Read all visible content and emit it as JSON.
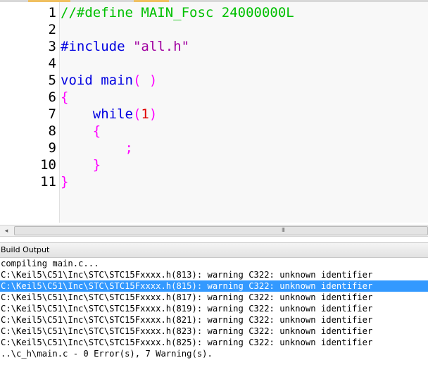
{
  "editor": {
    "lines": [
      {
        "num": "1",
        "segments": [
          {
            "text": "//#define MAIN_Fosc 24000000L",
            "cls": "c-comment"
          }
        ]
      },
      {
        "num": "2",
        "segments": []
      },
      {
        "num": "3",
        "segments": [
          {
            "text": "#include ",
            "cls": "c-kw"
          },
          {
            "text": "\"all.h\"",
            "cls": "c-str"
          }
        ]
      },
      {
        "num": "4",
        "segments": []
      },
      {
        "num": "5",
        "segments": [
          {
            "text": "void",
            "cls": "c-kw"
          },
          {
            "text": " main",
            "cls": "c-kw"
          },
          {
            "text": "( )",
            "cls": "c-paren"
          }
        ]
      },
      {
        "num": "6",
        "segments": [
          {
            "text": "{",
            "cls": "c-paren"
          }
        ]
      },
      {
        "num": "7",
        "segments": [
          {
            "text": "    while",
            "cls": "c-kw"
          },
          {
            "text": "(",
            "cls": "c-paren"
          },
          {
            "text": "1",
            "cls": "c-num"
          },
          {
            "text": ")",
            "cls": "c-paren"
          }
        ]
      },
      {
        "num": "8",
        "segments": [
          {
            "text": "    {",
            "cls": "c-paren"
          }
        ]
      },
      {
        "num": "9",
        "segments": [
          {
            "text": "        ;",
            "cls": "c-paren"
          }
        ]
      },
      {
        "num": "10",
        "segments": [
          {
            "text": "    }",
            "cls": "c-paren"
          }
        ]
      },
      {
        "num": "11",
        "segments": [
          {
            "text": "}",
            "cls": "c-paren"
          }
        ]
      }
    ]
  },
  "scrollbar": {
    "left_arrow": "◂",
    "grip": "III"
  },
  "build_output": {
    "title": "Build Output",
    "selected_index": 2,
    "lines": [
      "compiling main.c...",
      "C:\\Keil5\\C51\\Inc\\STC\\STC15Fxxxx.h(813): warning C322: unknown identifier",
      "C:\\Keil5\\C51\\Inc\\STC\\STC15Fxxxx.h(815): warning C322: unknown identifier",
      "C:\\Keil5\\C51\\Inc\\STC\\STC15Fxxxx.h(817): warning C322: unknown identifier",
      "C:\\Keil5\\C51\\Inc\\STC\\STC15Fxxxx.h(819): warning C322: unknown identifier",
      "C:\\Keil5\\C51\\Inc\\STC\\STC15Fxxxx.h(821): warning C322: unknown identifier",
      "C:\\Keil5\\C51\\Inc\\STC\\STC15Fxxxx.h(823): warning C322: unknown identifier",
      "C:\\Keil5\\C51\\Inc\\STC\\STC15Fxxxx.h(825): warning C322: unknown identifier",
      "..\\c_h\\main.c - 0 Error(s), 7 Warning(s)."
    ]
  },
  "colors": {
    "comment": "#00c000",
    "keyword": "#0000e0",
    "string": "#a000a0",
    "paren": "#ff00ff",
    "number": "#e00000",
    "selection": "#3399ff"
  }
}
